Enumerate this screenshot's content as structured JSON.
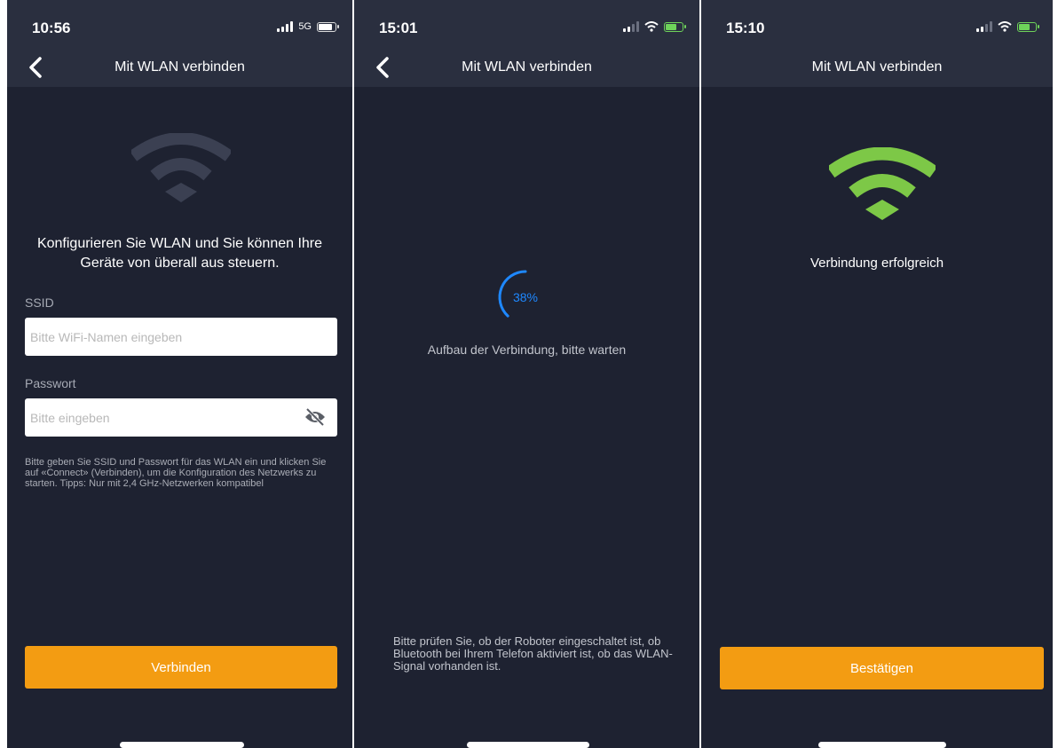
{
  "screens": [
    {
      "status": {
        "time": "10:56",
        "network": "5G"
      },
      "title": "Mit WLAN verbinden",
      "intro": "Konfigurieren Sie WLAN und Sie können Ihre Geräte von überall aus steuern.",
      "ssid_label": "SSID",
      "ssid_placeholder": "Bitte WiFi-Namen eingeben",
      "password_label": "Passwort",
      "password_placeholder": "Bitte eingeben",
      "hint": "Bitte geben Sie SSID und Passwort für das WLAN ein und klicken Sie auf «Connect» (Verbinden), um die Konfiguration des Netzwerks zu starten. Tipps: Nur mit 2,4 GHz-Netzwerken kompatibel",
      "button": "Verbinden",
      "icons": [
        "back-arrow-icon",
        "wifi-icon",
        "eye-off-icon"
      ]
    },
    {
      "status": {
        "time": "15:01"
      },
      "title": "Mit WLAN verbinden",
      "progress": {
        "label": "38%",
        "value": 0.38
      },
      "waiting": "Aufbau der Verbindung, bitte warten",
      "check_hint": "Bitte prüfen Sie, ob der Roboter eingeschaltet ist, ob Bluetooth bei Ihrem Telefon aktiviert ist, ob das WLAN-Signal vorhanden ist.",
      "icons": [
        "back-arrow-icon"
      ]
    },
    {
      "status": {
        "time": "15:10"
      },
      "title": "Mit WLAN verbinden",
      "success": "Verbindung erfolgreich",
      "button": "Bestätigen",
      "icons": [
        "wifi-icon"
      ]
    }
  ],
  "colors": {
    "background": "#1e2231",
    "header": "#2a2f3f",
    "accent": "#f39c12",
    "wifi_inactive": "#3b4052",
    "wifi_success": "#7dc847",
    "progress": "#1e88ff"
  }
}
